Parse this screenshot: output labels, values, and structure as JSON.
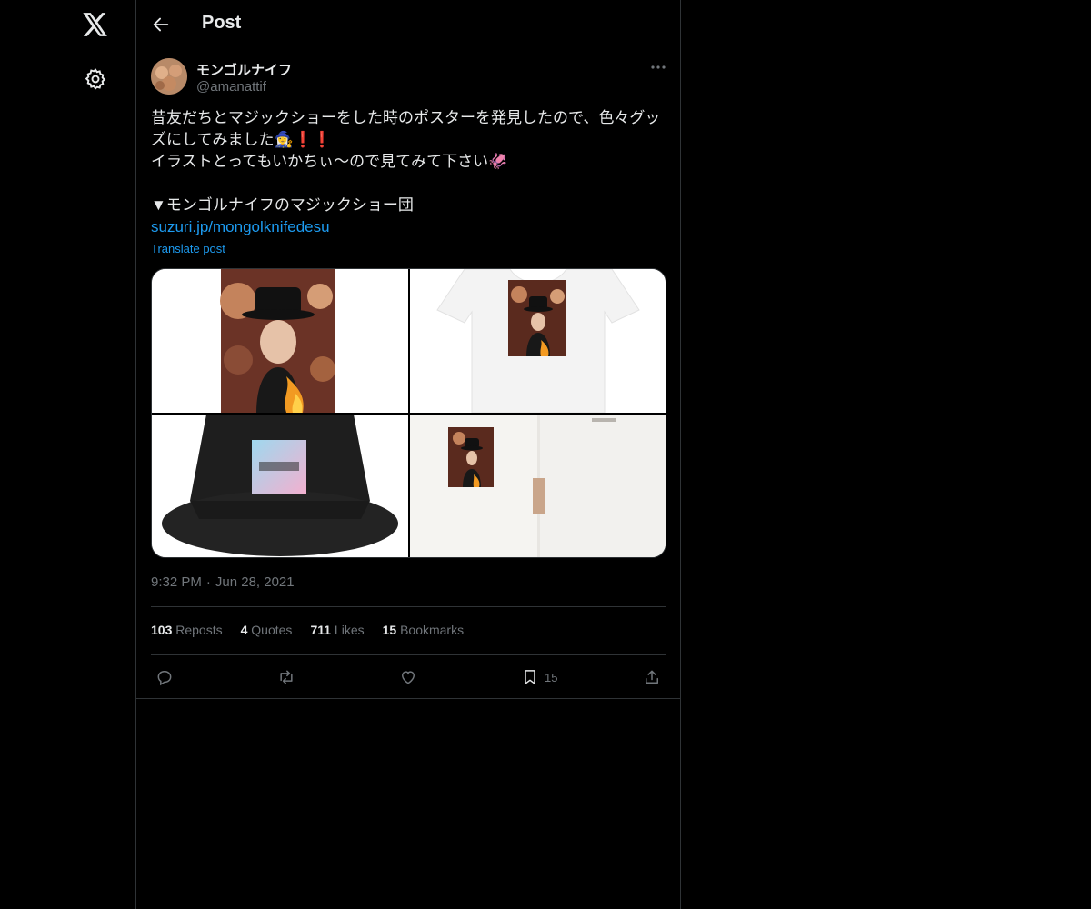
{
  "header": {
    "title": "Post"
  },
  "author": {
    "name": "モンゴルナイフ",
    "handle": "@amanattif"
  },
  "post": {
    "lines": [
      "昔友だちとマジックショーをした時のポスターを発見したので、色々グッ",
      "ズにしてみました🧙‍♀️❗❗",
      "イラストとってもいかちぃ〜ので見てみて下さい🦑",
      "",
      "▼モンゴルナイフのマジックショー団"
    ],
    "link": "suzuri.jp/mongolknifedesu",
    "translate": "Translate post",
    "time": "9:32 PM",
    "date": "Jun 28, 2021"
  },
  "stats": {
    "reposts_count": "103",
    "reposts_label": "Reposts",
    "quotes_count": "4",
    "quotes_label": "Quotes",
    "likes_count": "711",
    "likes_label": "Likes",
    "bookmarks_count": "15",
    "bookmarks_label": "Bookmarks"
  },
  "actions": {
    "bookmark_count": "15"
  },
  "colors": {
    "background": "#000000",
    "text": "#e7e9ea",
    "muted": "#71767b",
    "link": "#1d9bf0",
    "border": "#2f3336"
  },
  "icons": [
    "x-logo-icon",
    "gear-icon",
    "back-arrow-icon",
    "more-icon",
    "reply-icon",
    "repost-icon",
    "like-icon",
    "bookmark-icon",
    "share-icon"
  ]
}
